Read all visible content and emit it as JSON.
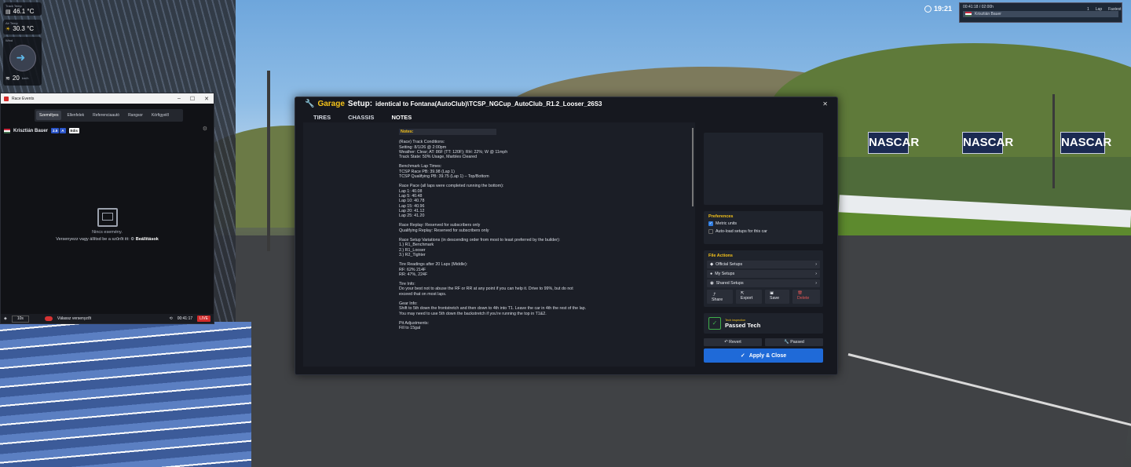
{
  "hud": {
    "track_temp_label": "Track Temp",
    "track_temp": "46.1 °C",
    "air_temp_label": "Air Temp",
    "air_temp": "30.3 °C",
    "wind_label": "Wind",
    "wind_speed": "20",
    "wind_unit": "km/h"
  },
  "clock": {
    "time": "19:21"
  },
  "session": {
    "elapsed": "00:41:18 / 02:00h",
    "count": "1",
    "driver": "Krisztián Bauer",
    "lap_label": "Lap",
    "fastest_label": "Fastest"
  },
  "race_events": {
    "title": "Race Events",
    "tabs": [
      "Személyes",
      "Ellenfelek",
      "Referenciaautó",
      "Rangsor",
      "Körfigyelő"
    ],
    "driver": "Krisztián Bauer",
    "rating": "2.5",
    "class": "A",
    "badge": "Edis",
    "empty_title": "Nincs esemény.",
    "empty_hint": "Versenyezz vagy állítsd be a szűrőt itt:",
    "empty_link": "Beállítások",
    "foot_select": "10s",
    "foot_toggle_label": "Válassz versenyzőt",
    "foot_time": "00:41:17",
    "foot_live": "LIVE"
  },
  "garage": {
    "title_prefix": "Garage",
    "title_suffix": "Setup:",
    "file": "identical to Fontana(AutoClub)\\TCSP_NGCup_AutoClub_R1.2_Looser_26S3",
    "tabs": [
      "TIRES",
      "CHASSIS",
      "NOTES"
    ],
    "notes_header": "Notes:",
    "notes": [
      "(Race) Track Conditions:\nSetting: 8/1/26 @ 2:00pm\nWeather: Clear; AT: 86F (TT: 120F); RH: 22%; W @ 11mph\nTrack State: 50% Usage, Marbles Cleared",
      "Benchmark Lap Times:\nTCSP Race PB: 39.98 (Lap 1)\nTCSP Qualifying PB: 39.75 (Lap 1) – Top/Bottom",
      "Race Pace (all laps were completed running the bottom):\nLap 1: 40.08\nLap 5: 40.48\nLap 10: 40.78\nLap 15: 40.96\nLap 20: 41.12\nLap 25: 41.20",
      "Race Replay: Reserved for subscribers only\nQualifying Replay: Reserved for subscribers only",
      "Race Setup Variations (in descending order from most to least preferred by the builder):\n1.) R1_Benchmark\n2.) R1_Looser\n3.) R2_Tighter",
      "Tire Readings after 20 Laps (Middle):\nRF: 62% 214F\nRR: 47%, 224F",
      "Tire Info:\nDo your best not to abuse the RF or RR at any point if you can help it. Drive to 99%, but do not exceed that on most laps.",
      "Gear Info:\nShift to 5th down the frontstretch and then down to 4th into T1. Leave the car in 4th the rest of the lap. You may need to use 5th down the backstretch if you're running the top in T1&2.",
      "Pit Adjustments:\nFill to 15gal"
    ],
    "preferences_title": "Preferences",
    "metric_units": "Metric units",
    "autoload": "Auto-load setups for this car",
    "file_actions_title": "File Actions",
    "official_setups": "Official Setups",
    "my_setups": "My Setups",
    "shared_setups": "Shared Setups",
    "share": "Share",
    "export": "Export",
    "save": "Save",
    "delete": "Delete",
    "tech_small": "Tech inspection",
    "tech_status": "Passed Tech",
    "revert": "Revert",
    "passed": "Passed",
    "apply_close": "Apply & Close"
  }
}
